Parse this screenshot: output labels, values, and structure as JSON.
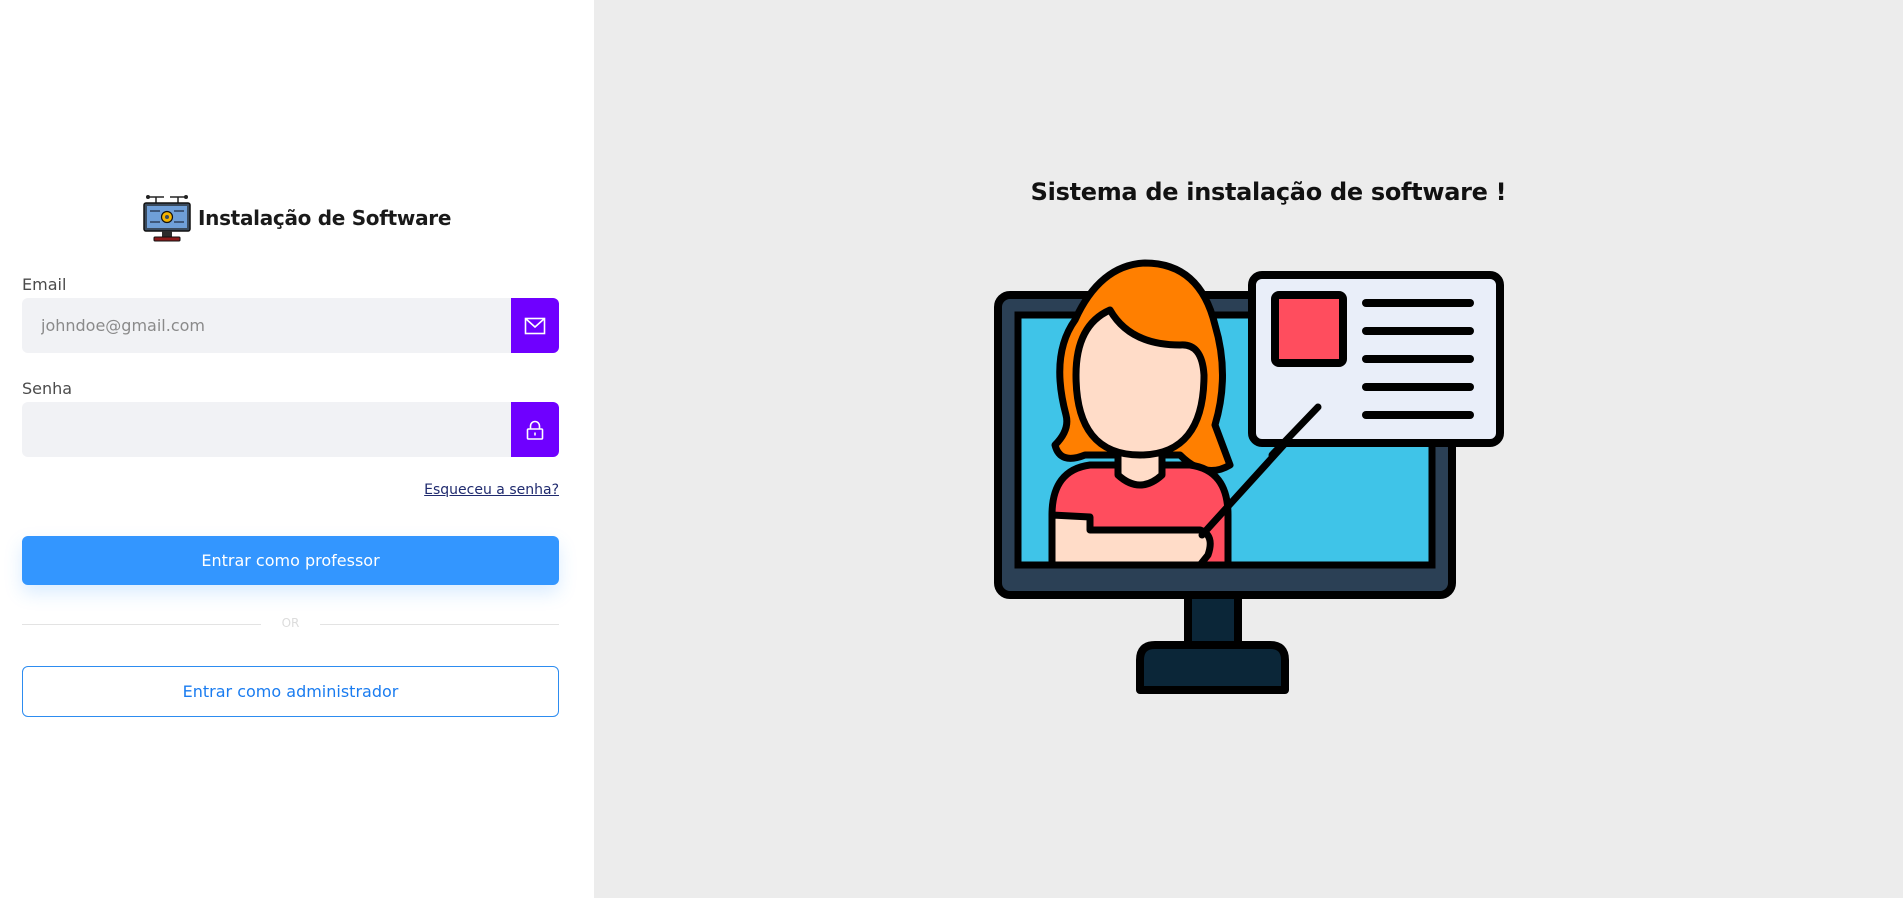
{
  "brand": {
    "title": "Instalação de Software",
    "logo_icon": "circuit-monitor-icon"
  },
  "login_form": {
    "email_label": "Email",
    "email_placeholder": "johndoe@gmail.com",
    "email_value": "",
    "email_icon": "envelope-icon",
    "password_label": "Senha",
    "password_value": "",
    "password_icon": "lock-icon",
    "forgot_link": "Esqueceu a senha?",
    "teacher_button": "Entrar como professor",
    "divider_text": "OR",
    "admin_button": "Entrar como administrador"
  },
  "hero": {
    "title": "Sistema de instalação de software !",
    "illustration_icon": "teacher-presentation-monitor-icon"
  },
  "colors": {
    "accent_purple": "#6f00ff",
    "primary_blue": "#3396ff",
    "outline_blue": "#2d8cf0",
    "right_panel_bg": "#ececec"
  }
}
